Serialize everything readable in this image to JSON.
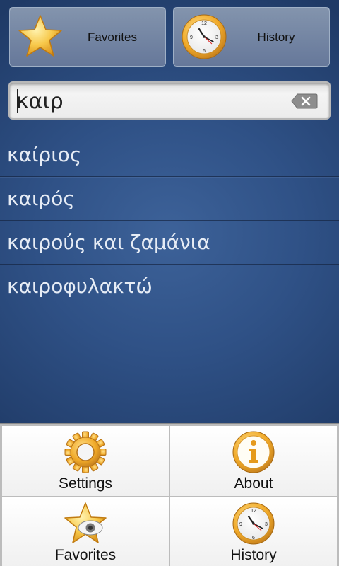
{
  "top_buttons": {
    "favorites": {
      "label": "Favorites",
      "icon": "star-icon"
    },
    "history": {
      "label": "History",
      "icon": "clock-icon"
    }
  },
  "search": {
    "value": "καιρ",
    "clear_icon": "backspace-clear-icon"
  },
  "results": [
    "καίριος",
    "καιρός",
    "καιρούς και ζαμάνια",
    "καιροφυλακτώ"
  ],
  "menu": {
    "items": [
      {
        "label": "Settings",
        "icon": "gear-icon"
      },
      {
        "label": "About",
        "icon": "info-icon"
      },
      {
        "label": "Favorites",
        "icon": "star-eye-icon"
      },
      {
        "label": "History",
        "icon": "clock-icon"
      }
    ]
  },
  "colors": {
    "background": "#2f5186",
    "icon_gold": "#f5b22a"
  }
}
